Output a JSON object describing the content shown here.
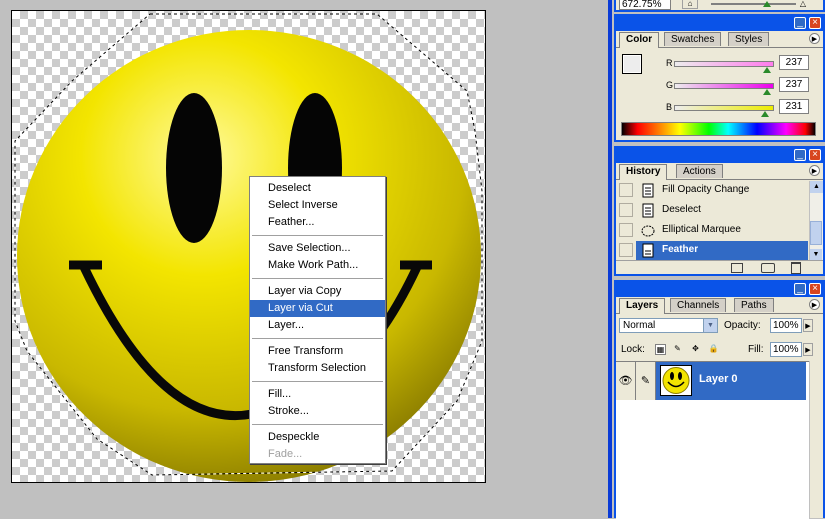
{
  "navigator": {
    "zoom": "672.75%"
  },
  "color_panel": {
    "tabs": [
      "Color",
      "Swatches",
      "Styles"
    ],
    "active_tab": "Color",
    "sliders": [
      {
        "letter": "R",
        "value": "237",
        "fraction": 0.929,
        "gradient": "#ff7bed"
      },
      {
        "letter": "G",
        "value": "237",
        "fraction": 0.929,
        "gradient": "#ed00ed"
      },
      {
        "letter": "B",
        "value": "231",
        "fraction": 0.906,
        "gradient": "#eded00"
      }
    ]
  },
  "history_panel": {
    "tabs": [
      "History",
      "Actions"
    ],
    "active_tab": "History",
    "items": [
      {
        "label": "Fill Opacity Change",
        "icon": "document-icon",
        "selected": false
      },
      {
        "label": "Deselect",
        "icon": "document-icon",
        "selected": false
      },
      {
        "label": "Elliptical Marquee",
        "icon": "ellipse-icon",
        "selected": false
      },
      {
        "label": "Feather",
        "icon": "document-icon",
        "selected": true
      }
    ]
  },
  "layers_panel": {
    "tabs": [
      "Layers",
      "Channels",
      "Paths"
    ],
    "active_tab": "Layers",
    "blend_mode": "Normal",
    "opacity_label": "Opacity:",
    "opacity_value": "100%",
    "lock_label": "Lock:",
    "fill_label": "Fill:",
    "fill_value": "100%",
    "layers": [
      {
        "name": "Layer 0",
        "selected": true
      }
    ]
  },
  "context_menu": {
    "groups": [
      [
        {
          "label": "Deselect"
        },
        {
          "label": "Select Inverse"
        },
        {
          "label": "Feather..."
        }
      ],
      [
        {
          "label": "Save Selection..."
        },
        {
          "label": "Make Work Path..."
        }
      ],
      [
        {
          "label": "Layer via Copy"
        },
        {
          "label": "Layer via Cut",
          "highlighted": true
        },
        {
          "label": "Layer..."
        }
      ],
      [
        {
          "label": "Free Transform"
        },
        {
          "label": "Transform Selection"
        }
      ],
      [
        {
          "label": "Fill..."
        },
        {
          "label": "Stroke..."
        }
      ],
      [
        {
          "label": "Despeckle"
        },
        {
          "label": "Fade...",
          "disabled": true
        }
      ]
    ]
  },
  "colors": {
    "accent": "#0a53e8",
    "selection": "#316ac5",
    "panel_bg": "#ece9d8",
    "smiley": "#f2e400"
  }
}
